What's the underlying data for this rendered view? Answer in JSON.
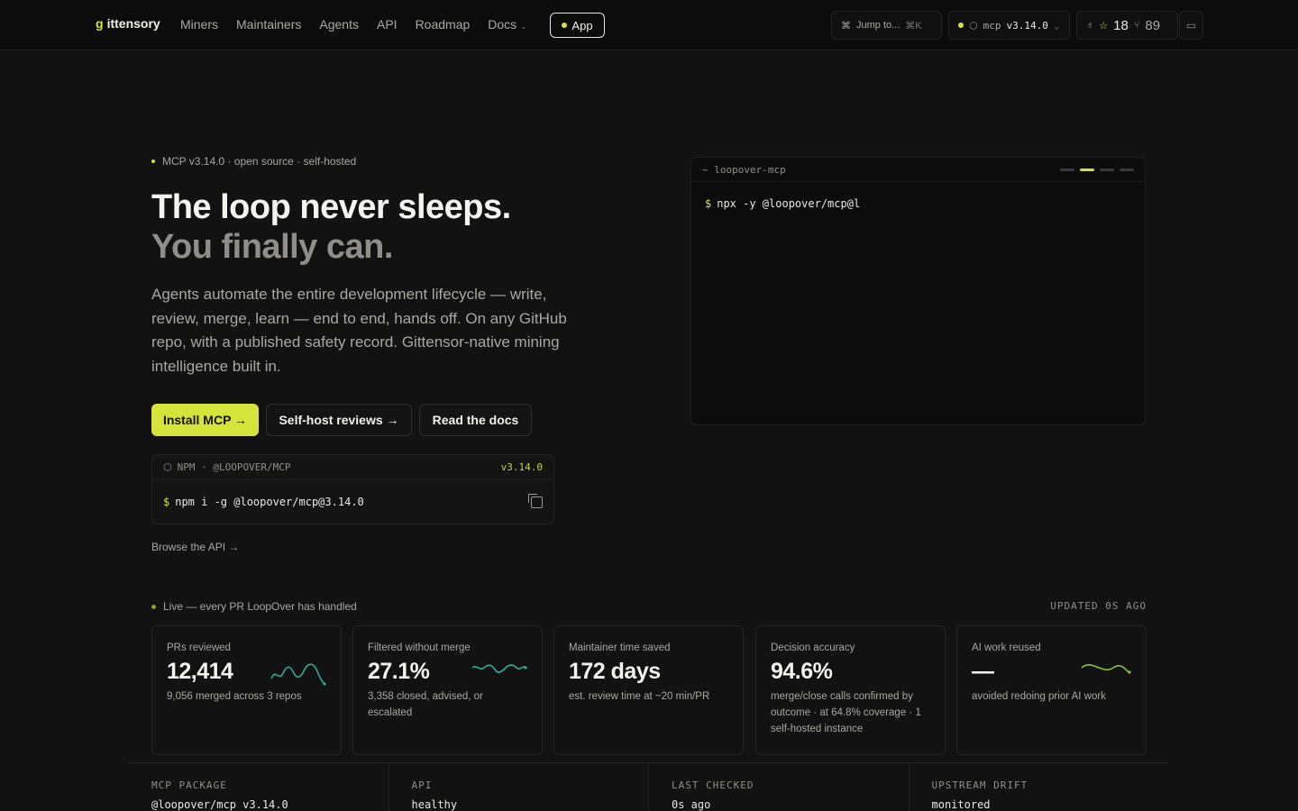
{
  "header": {
    "brand": "ittensory",
    "nav": [
      "Miners",
      "Maintainers",
      "Agents",
      "API",
      "Roadmap",
      "Docs"
    ],
    "app_label": "App",
    "jump_label": "Jump to...",
    "jump_kbd": "⌘K",
    "mcp_label": "mcp",
    "mcp_version": "v3.14.0",
    "stars": "18",
    "forks": "89",
    "accent": "#d4e43b"
  },
  "hero": {
    "eyebrow": "MCP v3.14.0 · open source · self-hosted",
    "title": "The loop never sleeps.",
    "subtitle": "You finally can.",
    "lede": "Agents automate the entire development lifecycle — write, review, merge, learn — end to end, hands off. On any GitHub repo, with a published safety record. Gittensor-native mining intelligence built in.",
    "btn_install": "Install MCP →",
    "btn_selfhost": "Self-host reviews →",
    "btn_docs": "Read the docs",
    "npm_label": "NPM · @LOOPOVER/MCP",
    "npm_version": "v3.14.0",
    "npm_cmd": "npm i -g @loopover/mcp@3.14.0",
    "browse": "Browse the API →"
  },
  "terminal": {
    "title": "~ loopover-mcp",
    "line": "npx -y @loopover/mcp@l"
  },
  "live": {
    "label": "Live — every PR LoopOver has handled",
    "updated": "UPDATED 0S AGO"
  },
  "stats": [
    {
      "label": "PRs reviewed",
      "value": "12,414",
      "sub": "9,056 merged across 3 repos"
    },
    {
      "label": "Filtered without merge",
      "value": "27.1%",
      "sub": "3,358 closed, advised, or escalated"
    },
    {
      "label": "Maintainer time saved",
      "value": "172 days",
      "sub": "est. review time at ~20 min/PR"
    },
    {
      "label": "Decision accuracy",
      "value": "94.6%",
      "sub": "merge/close calls confirmed by outcome · at 64.8% coverage · 1 self-hosted instance"
    },
    {
      "label": "AI work reused",
      "value": "—",
      "sub": "avoided redoing prior AI work"
    }
  ],
  "strip": [
    {
      "k": "MCP PACKAGE",
      "v": "@loopover/mcp v3.14.0"
    },
    {
      "k": "API",
      "v": "healthy"
    },
    {
      "k": "LAST CHECKED",
      "v": "0s ago"
    },
    {
      "k": "UPSTREAM DRIFT",
      "v": "monitored"
    }
  ]
}
